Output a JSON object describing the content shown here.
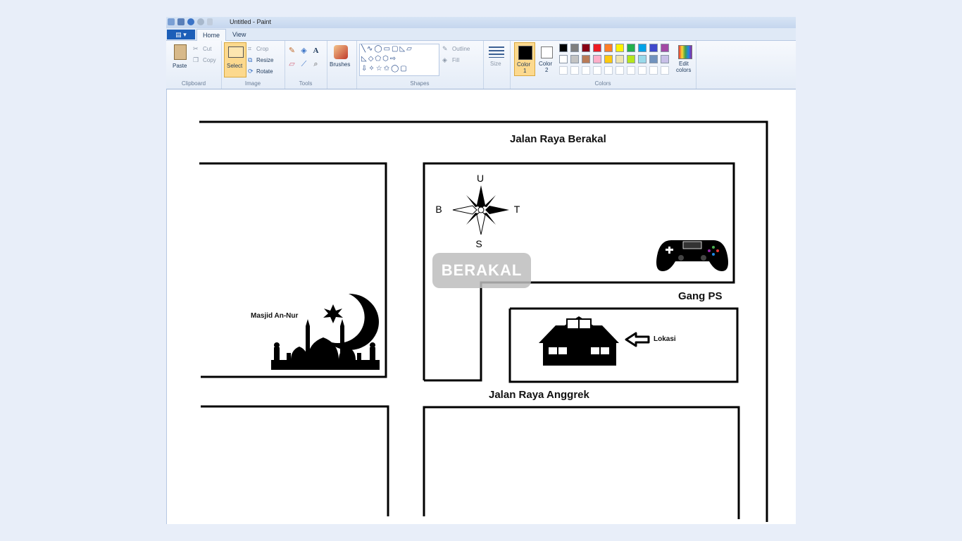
{
  "window": {
    "title": "Untitled - Paint"
  },
  "tabs": {
    "home": "Home",
    "view": "View"
  },
  "clipboard": {
    "paste": "Paste",
    "cut": "Cut",
    "copy": "Copy",
    "group": "Clipboard"
  },
  "image": {
    "select": "Select",
    "crop": "Crop",
    "resize": "Resize",
    "rotate": "Rotate",
    "group": "Image"
  },
  "tools": {
    "group": "Tools",
    "text_icon": "A"
  },
  "brushes": {
    "label": "Brushes"
  },
  "shapes": {
    "outline": "Outline",
    "fill": "Fill",
    "group": "Shapes"
  },
  "size": {
    "label": "Size"
  },
  "colors": {
    "color1": "Color",
    "color1_num": "1",
    "color2": "Color",
    "color2_num": "2",
    "edit1": "Edit",
    "edit2": "colors",
    "group": "Colors",
    "color1_value": "#000000",
    "color2_value": "#ffffff",
    "palette_row1": [
      "#000000",
      "#7f7f7f",
      "#880015",
      "#ed1c24",
      "#ff7f27",
      "#fff200",
      "#22b14c",
      "#00a2e8",
      "#3f48cc",
      "#a349a4"
    ],
    "palette_row2": [
      "#ffffff",
      "#c3c3c3",
      "#b97a57",
      "#ffaec9",
      "#ffc90e",
      "#efe4b0",
      "#b5e61d",
      "#99d9ea",
      "#7092be",
      "#c8bfe7"
    ]
  },
  "map": {
    "street_top": "Jalan Raya Berakal",
    "street_middle": "Jalan Raya Anggrek",
    "alley": "Gang PS",
    "mosque": "Masjid An-Nur",
    "location": "Lokasi",
    "watermark": "BERAKAL",
    "compass": {
      "north": "U",
      "south": "S",
      "east": "T",
      "west": "B"
    }
  }
}
